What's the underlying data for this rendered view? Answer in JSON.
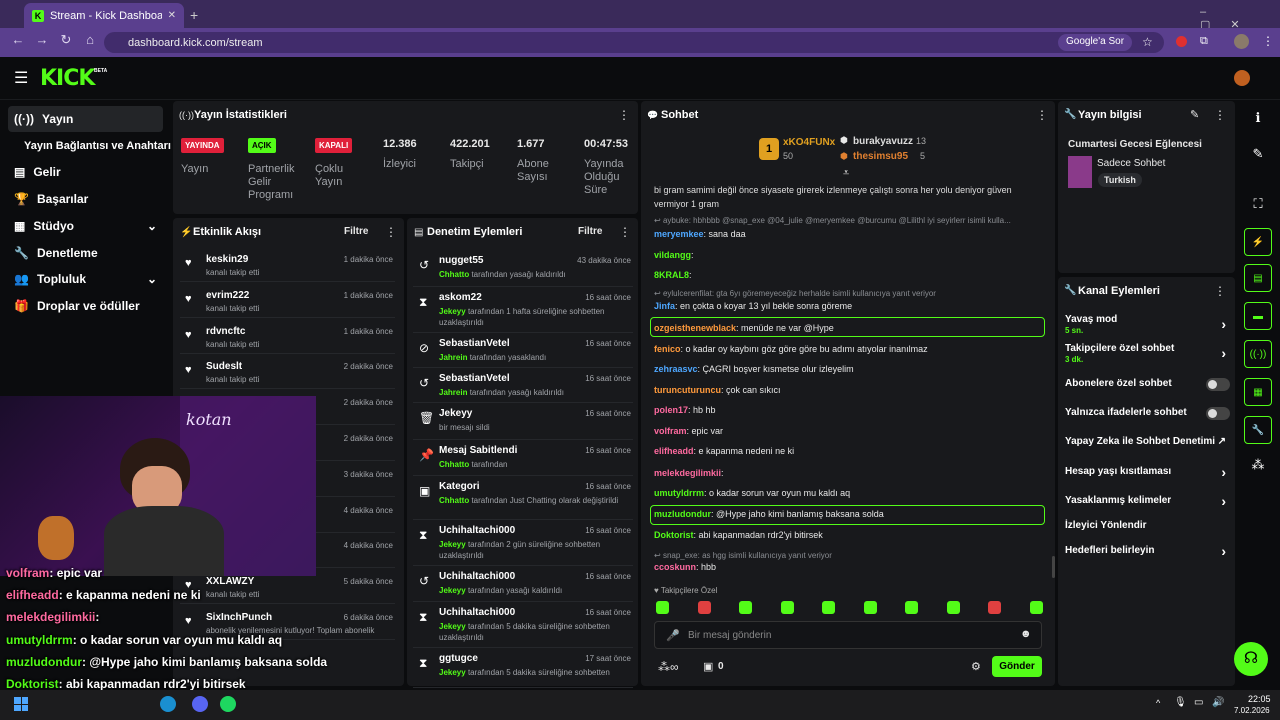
{
  "browser": {
    "tab_title": "Stream - Kick Dashboard",
    "url": "dashboard.kick.com/stream",
    "search_button": "Google'a Sor"
  },
  "logo": "KICK",
  "logo_badge": "BETA",
  "sidebar": {
    "items": [
      {
        "label": "Yayın",
        "icon": "stream-icon"
      },
      {
        "label": "Yayın Bağlantısı ve Anahtarı"
      },
      {
        "label": "Gelir",
        "icon": "revenue-icon"
      },
      {
        "label": "Başarılar",
        "icon": "trophy-icon"
      },
      {
        "label": "Stüdyo",
        "icon": "studio-icon"
      },
      {
        "label": "Denetleme",
        "icon": "wrench-icon"
      },
      {
        "label": "Topluluk",
        "icon": "community-icon"
      },
      {
        "label": "Droplar ve ödüller",
        "icon": "gift-icon"
      }
    ]
  },
  "stats": {
    "title": "Yayın İstatistikleri",
    "badges": [
      {
        "text": "YAYINDA",
        "color": "#e0203a",
        "label": "Yayın"
      },
      {
        "text": "AÇIK",
        "color": "#53fc18",
        "label": "Partnerlik Gelir Programı"
      },
      {
        "text": "KAPALI",
        "color": "#e0203a",
        "label": "Çoklu Yayın"
      }
    ],
    "values": [
      {
        "value": "12.386",
        "label": "İzleyici"
      },
      {
        "value": "422.201",
        "label": "Takipçi"
      },
      {
        "value": "1.677",
        "label": "Abone Sayısı"
      },
      {
        "value": "00:47:53",
        "label": "Yayında Olduğu Süre"
      }
    ]
  },
  "activity": {
    "title": "Etkinlik Akışı",
    "filter": "Filtre",
    "items": [
      {
        "name": "keskin29",
        "sub": "kanalı takip etti",
        "time": "1 dakika önce"
      },
      {
        "name": "evrim222",
        "sub": "kanalı takip etti",
        "time": "1 dakika önce"
      },
      {
        "name": "rdvncftc",
        "sub": "kanalı takip etti",
        "time": "1 dakika önce"
      },
      {
        "name": "Sudeslt",
        "sub": "kanalı takip etti",
        "time": "2 dakika önce"
      },
      {
        "name": "",
        "sub": "",
        "time": "2 dakika önce"
      },
      {
        "name": "",
        "sub": "",
        "time": "2 dakika önce"
      },
      {
        "name": "",
        "sub": "",
        "time": "3 dakika önce"
      },
      {
        "name": "",
        "sub": "",
        "time": "4 dakika önce"
      },
      {
        "name": "",
        "sub": "",
        "time": "4 dakika önce"
      },
      {
        "name": "XXLAWZY",
        "sub": "kanalı takip etti",
        "time": "5 dakika önce"
      },
      {
        "name": "SixInchPunch",
        "sub": "abonelik yenilemesini kutluyor! Toplam abonelik",
        "time": "6 dakika önce"
      }
    ]
  },
  "moderation": {
    "title": "Denetim Eylemleri",
    "filter": "Filtre",
    "items": [
      {
        "name": "nugget55",
        "actor": "Chhatto",
        "text": "tarafından yasağı kaldırıldı",
        "time": "43 dakika önce",
        "icon": "undo-icon"
      },
      {
        "name": "askom22",
        "actor": "Jekeyy",
        "text": "tarafından 1 hafta süreliğine sohbetten uzaklaştırıldı",
        "time": "16 saat önce",
        "icon": "hourglass-icon"
      },
      {
        "name": "SebastianVetel",
        "actor": "Jahrein",
        "text": "tarafından yasaklandı",
        "time": "16 saat önce",
        "icon": "ban-icon"
      },
      {
        "name": "SebastianVetel",
        "actor": "Jahrein",
        "text": "tarafından yasağı kaldırıldı",
        "time": "16 saat önce",
        "icon": "undo-icon"
      },
      {
        "name": "Jekeyy",
        "actor": "",
        "text": "bir mesajı sildi",
        "time": "16 saat önce",
        "icon": "trash-icon"
      },
      {
        "name": "Mesaj Sabitlendi",
        "actor": "Chhatto",
        "text": "tarafından",
        "time": "16 saat önce",
        "icon": "pin-icon"
      },
      {
        "name": "Kategori",
        "actor": "Chhatto",
        "text": "tarafından Just Chatting olarak değiştirildi",
        "time": "16 saat önce",
        "icon": "category-icon"
      },
      {
        "name": "Uchihaltachi000",
        "actor": "Jekeyy",
        "text": "tarafından 2 gün süreliğine sohbetten uzaklaştırıldı",
        "time": "16 saat önce",
        "icon": "hourglass-icon"
      },
      {
        "name": "Uchihaltachi000",
        "actor": "Jekeyy",
        "text": "tarafından yasağı kaldırıldı",
        "time": "16 saat önce",
        "icon": "undo-icon"
      },
      {
        "name": "Uchihaltachi000",
        "actor": "Jekeyy",
        "text": "tarafından 5 dakika süreliğine sohbetten uzaklaştırıldı",
        "time": "16 saat önce",
        "icon": "hourglass-icon"
      },
      {
        "name": "ggtugce",
        "actor": "Jekeyy",
        "text": "tarafından 5 dakika süreliğine sohbetten",
        "time": "17 saat önce",
        "icon": "hourglass-icon"
      }
    ]
  },
  "chat": {
    "title": "Sohbet",
    "top": [
      {
        "rank": "1",
        "name": "xKO4FUNx",
        "count": "50"
      },
      {
        "rank": "",
        "name": "burakyavuzz",
        "count": "13"
      },
      {
        "rank": "",
        "name": "thesimsu95",
        "count": "5"
      }
    ],
    "pinned": "bi gram samimi değil önce siyasete girerek izlenmeye çalıştı sonra her yolu deniyor güven vermiyor 1 gram",
    "messages": [
      {
        "reply": "aybuke: hbhbbb @snap_exe @04_julie @meryemkee @burcumu @Lilithl iyi seyirlerr isimli kulla..."
      },
      {
        "user": "meryemkee",
        "color": "#4ea7ff",
        "text": ": sana daa"
      },
      {
        "user": "vildangg",
        "color": "#53fc18",
        "text": ":"
      },
      {
        "user": "8KRAL8",
        "color": "#53fc18",
        "text": ":"
      },
      {
        "reply": "eylulcerenfilat: gta 6yı göremeyeceğiz herhalde isimli kullanıcıya yanıt veriyor"
      },
      {
        "user": "Jinfa",
        "color": "#4ea7ff",
        "text": ": en çokta o koyar 13 yıl bekle sonra göreme"
      },
      {
        "user": "ozgeisthenewblack",
        "color": "#ff9a3c",
        "text": ": menüde ne var @Hype"
      },
      {
        "user": "fenico",
        "color": "#ff9a3c",
        "text": ": o kadar oy kaybını göz göre göre bu adımı atıyolar inanılmaz"
      },
      {
        "user": "zehraasvc",
        "color": "#4ea7ff",
        "text": ": ÇAGRI boşver kısmetse olur izleyelim"
      },
      {
        "user": "turuncuturuncu",
        "color": "#ff9a3c",
        "text": ": çok can sıkıcı"
      },
      {
        "user": "polen17",
        "color": "#ff6aa0",
        "text": ": hb hb"
      },
      {
        "user": "volfram",
        "color": "#ff6aa0",
        "text": ": epic var"
      },
      {
        "user": "elifheadd",
        "color": "#ff6aa0",
        "text": ": e kapanma nedeni ne ki"
      },
      {
        "user": "melekdegilimkii",
        "color": "#ff6aa0",
        "text": ":"
      },
      {
        "user": "umutyldrrm",
        "color": "#53fc18",
        "text": ": o kadar sorun var oyun mu kaldı aq"
      },
      {
        "user": "muzludondur",
        "color": "#53fc18",
        "text": ": @Hype jaho kimi banlamış baksana solda"
      },
      {
        "user": "Doktorist",
        "color": "#53fc18",
        "text": ": abi kapanmadan rdr2'yi bitirsek"
      },
      {
        "reply": "snap_exe: as hgg isimli kullanıcıya yanıt veriyor"
      },
      {
        "user": "ccoskunn",
        "color": "#ff6aa0",
        "text": ": hbb"
      }
    ],
    "followers_only": "Takipçilere Özel",
    "input_placeholder": "Bir mesaj gönderin",
    "points": "0",
    "send": "Gönder"
  },
  "stream_info": {
    "title": "Yayın bilgisi",
    "stream_title": "Cumartesi Gecesi Eğlencesi",
    "category": "Sadece Sohbet",
    "tag": "Turkish"
  },
  "channel_actions": {
    "title": "Kanal Eylemleri",
    "items": [
      {
        "label": "Yavaş mod",
        "sub": "5 sn.",
        "type": "arrow"
      },
      {
        "label": "Takipçilere özel sohbet",
        "sub": "3 dk.",
        "type": "arrow"
      },
      {
        "label": "Abonelere özel sohbet",
        "type": "toggle"
      },
      {
        "label": "Yalnızca ifadelerle sohbet",
        "type": "toggle"
      },
      {
        "label": "Yapay Zeka ile Sohbet Denetimi",
        "type": "external"
      },
      {
        "label": "Hesap yaşı kısıtlaması",
        "type": "arrow"
      },
      {
        "label": "Yasaklanmış kelimeler",
        "type": "arrow"
      },
      {
        "label": "İzleyici Yönlendir",
        "type": "none"
      },
      {
        "label": "Hedefleri belirleyin",
        "type": "arrow"
      }
    ]
  },
  "overlay_chat": [
    {
      "user": "volfram",
      "text": ": epic var",
      "color": "#ff6aa0"
    },
    {
      "user": "elifheadd",
      "text": ": e kapanma nedeni ne ki",
      "color": "#ff6aa0"
    },
    {
      "user": "melekdegilimkii",
      "text": ":",
      "color": "#ff6aa0"
    },
    {
      "user": "umutyldrrm",
      "text": ": o kadar sorun var oyun mu kaldı aq",
      "color": "#53fc18"
    },
    {
      "user": "muzludondur",
      "text": ": @Hype jaho kimi banlamış baksana solda",
      "color": "#53fc18"
    },
    {
      "user": "Doktorist",
      "text": ": abi kapanmadan rdr2'yi bitirsek",
      "color": "#53fc18"
    },
    {
      "user": "ccoskunn",
      "text": ": hbb",
      "color": "#ff6aa0"
    }
  ],
  "webcam_sign": "kotan",
  "taskbar": {
    "time": "22:05",
    "date": "7.02.2026"
  }
}
